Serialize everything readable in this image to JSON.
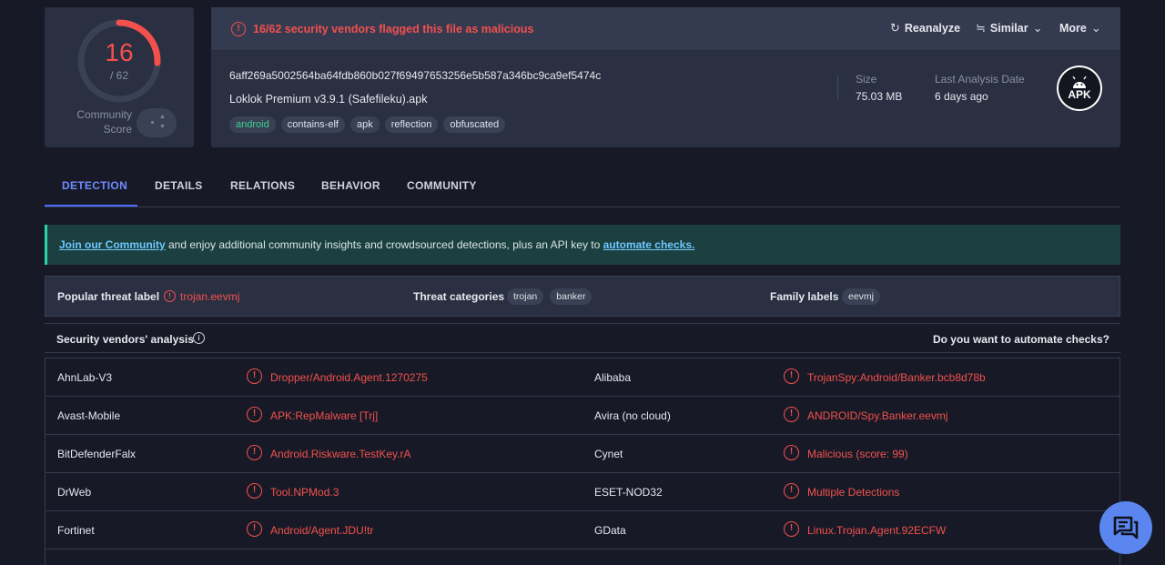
{
  "score": {
    "detections": "16",
    "total": "/ 62",
    "community_label_1": "Community",
    "community_label_2": "Score",
    "detection_ratio": 0.258
  },
  "banner": {
    "text": "16/62 security vendors flagged this file as malicious"
  },
  "actions": {
    "reanalyze": "Reanalyze",
    "similar": "Similar",
    "more": "More"
  },
  "file": {
    "hash": "6aff269a5002564ba64fdb860b027f69497653256e5b587a346bc9ca9ef5474c",
    "name": "Loklok Premium v3.9.1 (Safefileku).apk",
    "tags": [
      "android",
      "contains-elf",
      "apk",
      "reflection",
      "obfuscated"
    ],
    "size_label": "Size",
    "size_value": "75.03 MB",
    "date_label": "Last Analysis Date",
    "date_value": "6 days ago",
    "type_badge": "APK"
  },
  "tabs": [
    "DETECTION",
    "DETAILS",
    "RELATIONS",
    "BEHAVIOR",
    "COMMUNITY"
  ],
  "community_banner": {
    "link1": "Join our Community",
    "middle": " and enjoy additional community insights and crowdsourced detections, plus an API key to ",
    "link2": "automate checks."
  },
  "threat": {
    "popular_label": "Popular threat label",
    "popular_value": "trojan.eevmj",
    "categories_label": "Threat categories",
    "categories": [
      "trojan",
      "banker"
    ],
    "family_label": "Family labels",
    "families": [
      "eevmj"
    ]
  },
  "vendors_header": {
    "title": "Security vendors' analysis",
    "automate": "Do you want to automate checks?"
  },
  "vendors": [
    {
      "left_name": "AhnLab-V3",
      "left_result": "Dropper/Android.Agent.1270275",
      "right_name": "Alibaba",
      "right_result": "TrojanSpy:Android/Banker.bcb8d78b"
    },
    {
      "left_name": "Avast-Mobile",
      "left_result": "APK:RepMalware [Trj]",
      "right_name": "Avira (no cloud)",
      "right_result": "ANDROID/Spy.Banker.eevmj"
    },
    {
      "left_name": "BitDefenderFalx",
      "left_result": "Android.Riskware.TestKey.rA",
      "right_name": "Cynet",
      "right_result": "Malicious (score: 99)"
    },
    {
      "left_name": "DrWeb",
      "left_result": "Tool.NPMod.3",
      "right_name": "ESET-NOD32",
      "right_result": "Multiple Detections"
    },
    {
      "left_name": "Fortinet",
      "left_result": "Android/Agent.JDU!tr",
      "right_name": "GData",
      "right_result": "Linux.Trojan.Agent.92ECFW"
    }
  ],
  "colors": {
    "malicious": "#f3504d",
    "accent": "#4d6bff",
    "background": "#171a26",
    "card": "#2a3042"
  },
  "icons": {
    "alert": "alert-circle-icon",
    "reanalyze": "refresh-icon",
    "similar": "similar-icon",
    "more": "chevron-down-icon",
    "chat": "chat-icon",
    "file_type": "android-apk-icon"
  }
}
